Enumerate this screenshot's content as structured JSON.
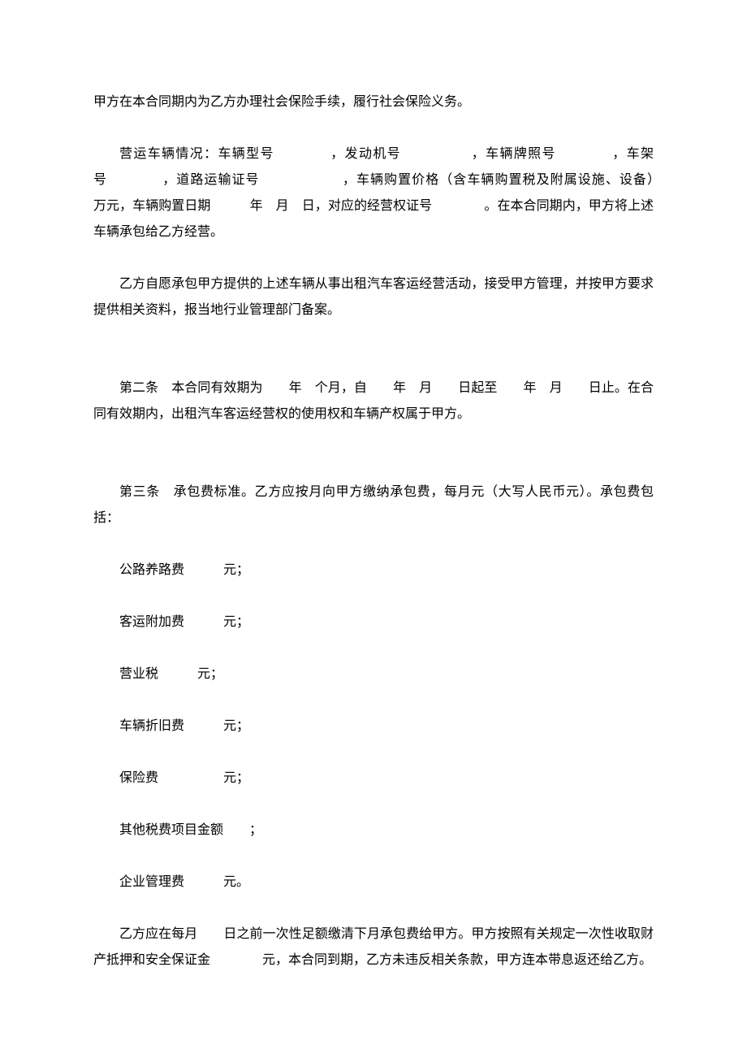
{
  "p1": "甲方在本合同期内为乙方办理社会保险手续，履行社会保险义务。",
  "p2": "营运车辆情况：车辆型号　　　　，发动机号　　　　　，车辆牌照号　　　　，车架号　　　　，道路运输证号　　　　　　，车辆购置价格（含车辆购置税及附属设施、设备）　　　　万元，车辆购置日期　　　年　月　日，对应的经营权证号　　　　。在本合同期内，甲方将上述车辆承包给乙方经营。",
  "p3": "乙方自愿承包甲方提供的上述车辆从事出租汽车客运经营活动，接受甲方管理，并按甲方要求提供相关资料，报当地行业管理部门备案。",
  "p4": "第二条　本合同有效期为　　年　个月，自　　年　月　　日起至　　年　月　　日止。在合同有效期内，出租汽车客运经营权的使用权和车辆产权属于甲方。",
  "p5": "第三条　承包费标准。乙方应按月向甲方缴纳承包费，每月元（大写人民币元）。承包费包括：",
  "items": [
    "公路养路费　　　元；",
    "客运附加费　　　元；",
    "营业税　　　元；",
    "车辆折旧费　　　元；",
    "保险费　　　　　元；",
    "其他税费项目金额　　；",
    "企业管理费　　　元。"
  ],
  "p6": "乙方应在每月　　日之前一次性足额缴清下月承包费给甲方。甲方按照有关规定一次性收取财产抵押和安全保证金　　　　元，本合同到期，乙方未违反相关条款，甲方连本带息返还给乙方。"
}
